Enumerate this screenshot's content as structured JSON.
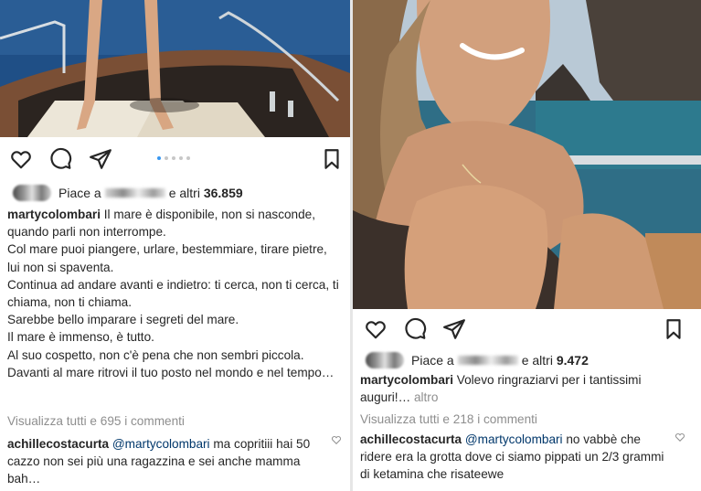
{
  "left": {
    "likes": {
      "prefix": "Piace a",
      "suffix": "e altri",
      "count": "36.859"
    },
    "caption": {
      "user": "martycolombari",
      "lines": [
        "Il mare è disponibile, non si nasconde, quando parli non interrompe.",
        "Col mare puoi piangere, urlare, bestemmiare, tirare pietre, lui non si spaventa.",
        "Continua ad andare avanti e indietro: ti cerca, non ti cerca, ti chiama, non ti chiama.",
        "Sarebbe bello imparare i segreti del mare.",
        "Il mare è immenso, è tutto.",
        "Al suo cospetto, non c'è pena che non sembri piccola.",
        "Davanti al mare ritrovi il tuo posto nel mondo e nel tempo…"
      ]
    },
    "view_all": "Visualizza tutti e 695 i commenti",
    "comment": {
      "user": "achillecostacurta",
      "mention": "@martycolombari",
      "text": "ma copritiii hai 50 cazzo non sei più una ragazzina e sei anche mamma bah…"
    }
  },
  "right": {
    "likes": {
      "prefix": "Piace a",
      "suffix": "e altri",
      "count": "9.472"
    },
    "caption": {
      "user": "martycolombari",
      "text": "Volevo ringraziarvi per i tantissimi auguri!…",
      "more": "altro"
    },
    "view_all": "Visualizza tutti e 218 i commenti",
    "comment": {
      "user": "achillecostacurta",
      "mention": "@martycolombari",
      "text": "no vabbè che ridere era la grotta dove ci siamo pippati un 2/3 grammi di ketamina che risateewe"
    }
  },
  "colors": {
    "text": "#262626",
    "muted": "#8e8e8e",
    "mention": "#00376b",
    "active_dot": "#3897f0",
    "sea": "#1f4f86"
  },
  "icons": [
    "heart-icon",
    "comment-icon",
    "share-icon",
    "bookmark-icon"
  ]
}
